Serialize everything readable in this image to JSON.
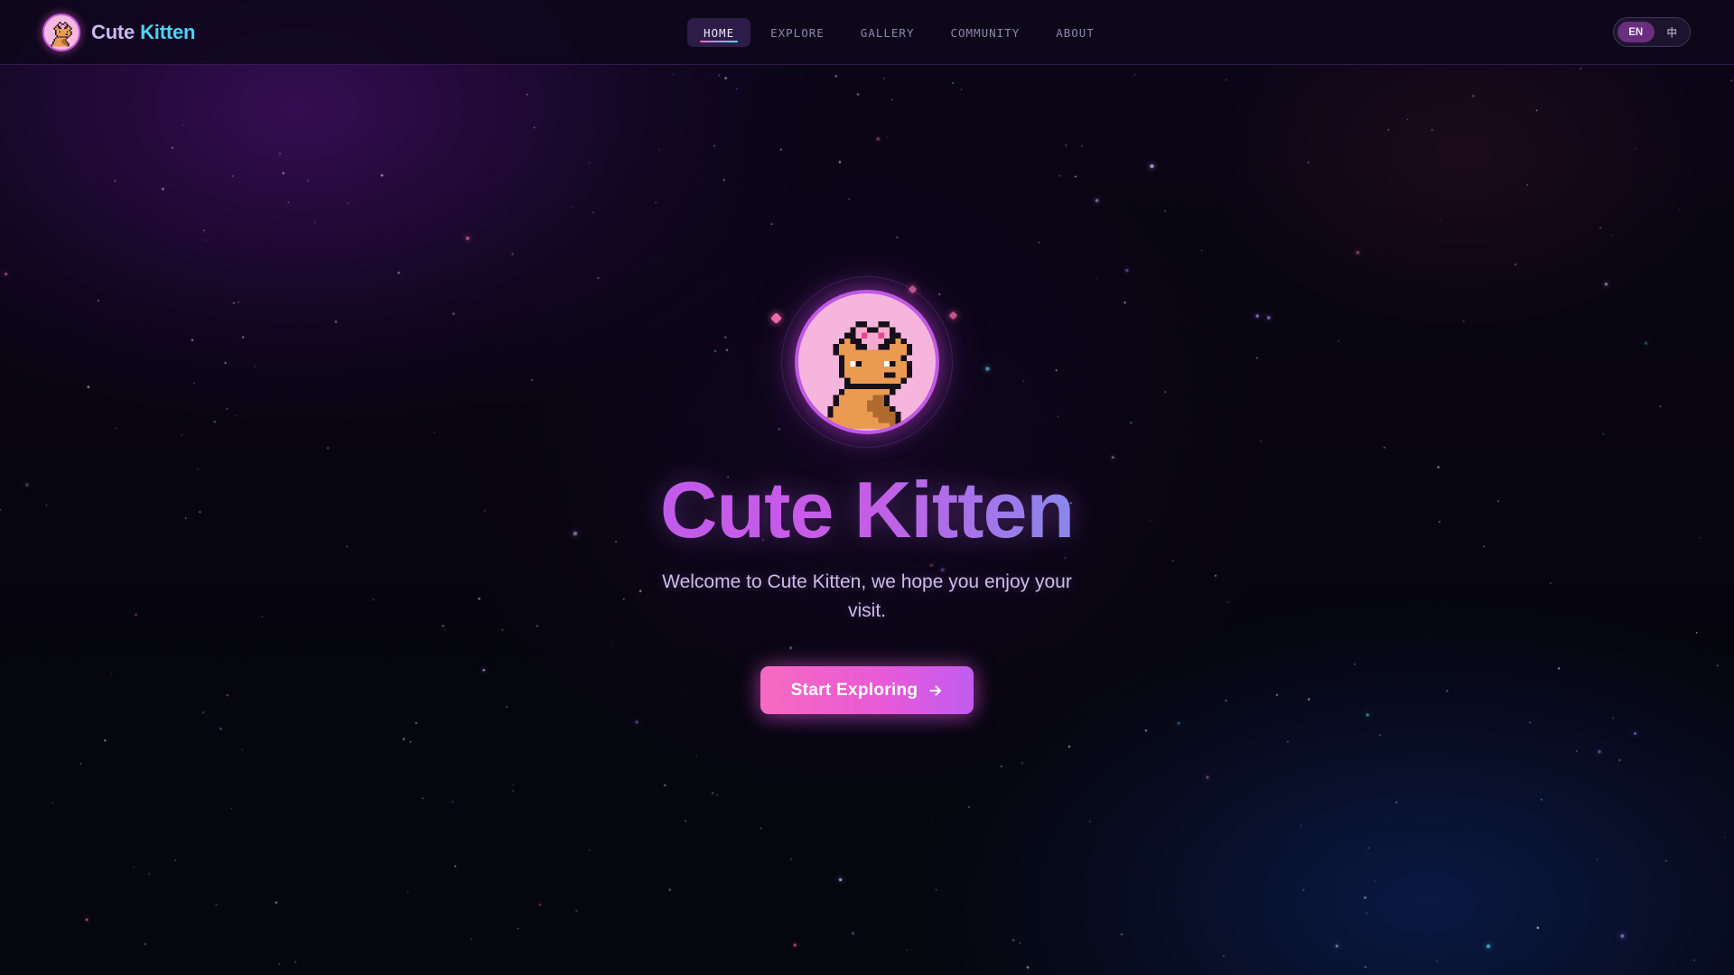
{
  "brand": {
    "name_part1": "Cute",
    "name_part2": "Kitten",
    "logo_icon": "pixel-kitten-icon"
  },
  "nav": {
    "items": [
      {
        "label": "HOME",
        "active": true
      },
      {
        "label": "EXPLORE",
        "active": false
      },
      {
        "label": "GALLERY",
        "active": false
      },
      {
        "label": "COMMUNITY",
        "active": false
      },
      {
        "label": "ABOUT",
        "active": false
      }
    ]
  },
  "language": {
    "options": [
      {
        "label": "EN",
        "active": true
      },
      {
        "label": "中",
        "active": false
      }
    ]
  },
  "hero": {
    "title": "Cute Kitten",
    "subtitle": "Welcome to Cute Kitten, we hope you enjoy your visit.",
    "cta_label": "Start Exploring",
    "cta_icon": "arrow-right-icon",
    "avatar_icon": "pixel-kitten-icon"
  },
  "colors": {
    "accent_pink": "#f76ac0",
    "accent_purple": "#c15cf0",
    "accent_cyan": "#4fd3f3",
    "background": "#06040f"
  }
}
